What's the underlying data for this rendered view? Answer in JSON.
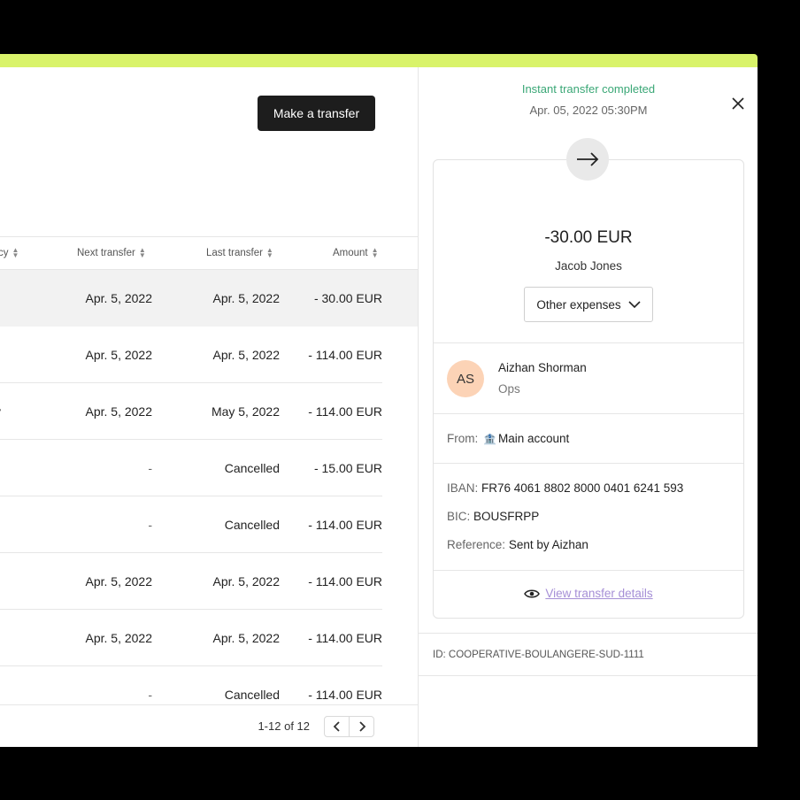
{
  "toolbar": {
    "make_transfer_label": "Make a transfer"
  },
  "table": {
    "headers": {
      "frequency": "cy",
      "next_transfer": "Next transfer",
      "last_transfer": "Last transfer",
      "amount": "Amount"
    },
    "rows": [
      {
        "freq": "",
        "next": "Apr. 5, 2022",
        "last": "Apr. 5, 2022",
        "amount": "- 30.00 EUR"
      },
      {
        "freq": "",
        "next": "Apr. 5, 2022",
        "last": "Apr. 5, 2022",
        "amount": "- 114.00 EUR"
      },
      {
        "freq": "y",
        "next": "Apr. 5, 2022",
        "last": "May 5, 2022",
        "amount": "- 114.00 EUR"
      },
      {
        "freq": "",
        "next": "-",
        "last": "Cancelled",
        "amount": "- 15.00 EUR"
      },
      {
        "freq": "",
        "next": "-",
        "last": "Cancelled",
        "amount": "- 114.00 EUR"
      },
      {
        "freq": "",
        "next": "Apr. 5, 2022",
        "last": "Apr. 5, 2022",
        "amount": "- 114.00 EUR"
      },
      {
        "freq": "",
        "next": "Apr. 5, 2022",
        "last": "Apr. 5, 2022",
        "amount": "- 114.00 EUR"
      },
      {
        "freq": "",
        "next": "-",
        "last": "Cancelled",
        "amount": "- 114.00 EUR"
      }
    ]
  },
  "pagination": {
    "text": "1-12 of 12"
  },
  "panel": {
    "status": "Instant transfer completed",
    "datetime": "Apr. 05, 2022 05:30PM",
    "amount": "-30.00 EUR",
    "recipient": "Jacob Jones",
    "category": "Other expenses",
    "person": {
      "initials": "AS",
      "name": "Aizhan Shorman",
      "role": "Ops"
    },
    "from": {
      "label": "From:",
      "value": "Main account"
    },
    "iban": {
      "label": "IBAN:",
      "value": "FR76 4061 8802 8000 0401 6241 593"
    },
    "bic": {
      "label": "BIC:",
      "value": "BOUSFRPP"
    },
    "reference": {
      "label": "Reference:",
      "value": "Sent by Aizhan"
    },
    "view_details": "View transfer details",
    "id": "ID: COOPERATIVE-BOULANGERE-SUD-1111"
  },
  "colors": {
    "accent": "#d9f36a",
    "status_green": "#3aa776",
    "link_purple": "#a58fd6",
    "avatar_bg": "#fcd3b6",
    "button_dark": "#1d1d1d"
  }
}
